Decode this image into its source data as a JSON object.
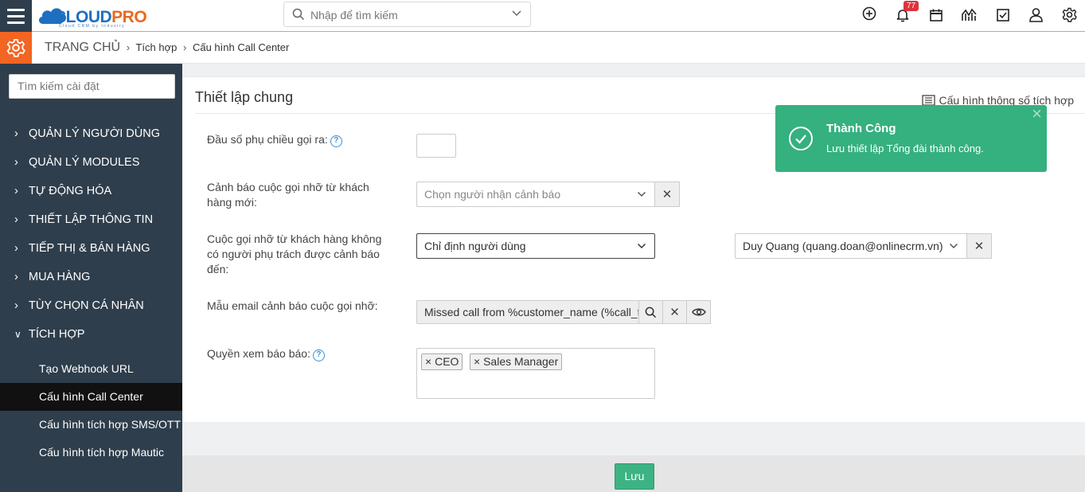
{
  "header": {
    "logo_part1": "CLOUD",
    "logo_part2": "PRO",
    "logo_subtitle": "Cloud CRM by Industry",
    "search_placeholder": "Nhập để tìm kiếm",
    "notification_count": "77",
    "icons": [
      "plus-circle-icon",
      "bell-icon",
      "calendar-icon",
      "chart-icon",
      "checkbox-icon",
      "user-icon",
      "settings-icon"
    ]
  },
  "breadcrumb": {
    "home": "TRANG CHỦ",
    "level1": "Tích hợp",
    "level2": "Cấu hình Call Center"
  },
  "sidebar": {
    "search_placeholder": "Tìm kiếm cài đặt",
    "items": [
      {
        "label": "QUẢN LÝ NGƯỜI DÙNG",
        "expanded": false
      },
      {
        "label": "QUẢN LÝ MODULES",
        "expanded": false
      },
      {
        "label": "TỰ ĐỘNG HÓA",
        "expanded": false
      },
      {
        "label": "THIẾT LẬP THÔNG TIN",
        "expanded": false
      },
      {
        "label": "TIẾP THỊ & BÁN HÀNG",
        "expanded": false
      },
      {
        "label": "MUA HÀNG",
        "expanded": false
      },
      {
        "label": "TÙY CHỌN CÁ NHÂN",
        "expanded": false
      },
      {
        "label": "TÍCH HỢP",
        "expanded": true
      }
    ],
    "subitems": [
      {
        "label": "Tạo Webhook URL",
        "active": false
      },
      {
        "label": "Cấu hình Call Center",
        "active": true
      },
      {
        "label": "Cấu hình tích hợp SMS/OTT",
        "active": false
      },
      {
        "label": "Cấu hình tích hợp Mautic",
        "active": false
      }
    ]
  },
  "main": {
    "title": "Thiết lập chung",
    "config_link": "Cấu hình thông số tích hợp",
    "fields": {
      "prefix_label": "Đầu số phụ chiều gọi ra:",
      "prefix_value": "",
      "missed_new_label": "Cảnh báo cuộc gọi nhỡ từ khách hàng mới:",
      "missed_new_placeholder": "Chọn người nhận cảnh báo",
      "missed_unassigned_label": "Cuộc gọi nhỡ từ khách hàng không có người phụ trách được cảnh báo đến:",
      "missed_unassigned_value": "Chỉ định người dùng",
      "assigned_user_value": "Duy Quang (quang.doan@onlinecrm.vn)",
      "email_template_label": "Mẫu email cảnh báo cuộc gọi nhỡ:",
      "email_template_value": "Missed call from %customer_name (%call_t",
      "report_view_label": "Quyền xem báo báo:",
      "report_view_tags": [
        "CEO",
        "Sales Manager"
      ]
    }
  },
  "footer": {
    "save_label": "Lưu"
  },
  "toast": {
    "title": "Thành Công",
    "message": "Lưu thiết lập Tổng đài thành công.",
    "close": "×"
  },
  "colors": {
    "sidebar_bg": "#2f3e4c",
    "accent_orange": "#f26522",
    "success_green": "#35b07f",
    "notification_red": "#e0323c"
  }
}
